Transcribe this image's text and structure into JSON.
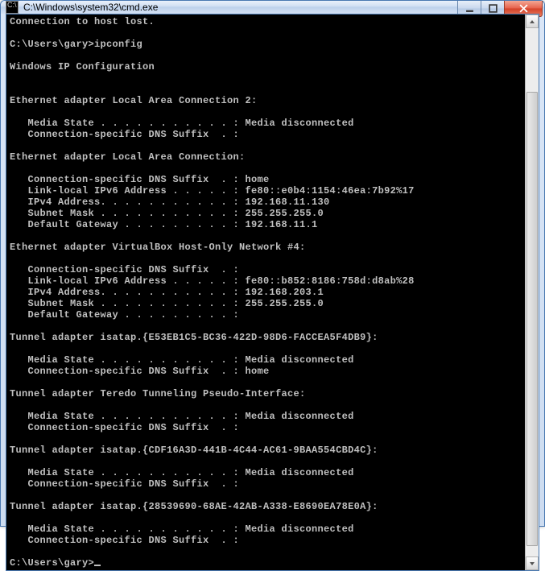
{
  "window": {
    "title": "C:\\Windows\\system32\\cmd.exe",
    "icon_glyph": "C:\\"
  },
  "scrollbar": {
    "thumb_top_pct": 12,
    "thumb_height_pct": 86
  },
  "console_lines": [
    "Connection to host lost.",
    "",
    "C:\\Users\\gary>ipconfig",
    "",
    "Windows IP Configuration",
    "",
    "",
    "Ethernet adapter Local Area Connection 2:",
    "",
    "   Media State . . . . . . . . . . . : Media disconnected",
    "   Connection-specific DNS Suffix  . :",
    "",
    "Ethernet adapter Local Area Connection:",
    "",
    "   Connection-specific DNS Suffix  . : home",
    "   Link-local IPv6 Address . . . . . : fe80::e0b4:1154:46ea:7b92%17",
    "   IPv4 Address. . . . . . . . . . . : 192.168.11.130",
    "   Subnet Mask . . . . . . . . . . . : 255.255.255.0",
    "   Default Gateway . . . . . . . . . : 192.168.11.1",
    "",
    "Ethernet adapter VirtualBox Host-Only Network #4:",
    "",
    "   Connection-specific DNS Suffix  . :",
    "   Link-local IPv6 Address . . . . . : fe80::b852:8186:758d:d8ab%28",
    "   IPv4 Address. . . . . . . . . . . : 192.168.203.1",
    "   Subnet Mask . . . . . . . . . . . : 255.255.255.0",
    "   Default Gateway . . . . . . . . . :",
    "",
    "Tunnel adapter isatap.{E53EB1C5-BC36-422D-98D6-FACCEA5F4DB9}:",
    "",
    "   Media State . . . . . . . . . . . : Media disconnected",
    "   Connection-specific DNS Suffix  . : home",
    "",
    "Tunnel adapter Teredo Tunneling Pseudo-Interface:",
    "",
    "   Media State . . . . . . . . . . . : Media disconnected",
    "   Connection-specific DNS Suffix  . :",
    "",
    "Tunnel adapter isatap.{CDF16A3D-441B-4C44-AC61-9BAA554CBD4C}:",
    "",
    "   Media State . . . . . . . . . . . : Media disconnected",
    "   Connection-specific DNS Suffix  . :",
    "",
    "Tunnel adapter isatap.{28539690-68AE-42AB-A338-E8690EA78E0A}:",
    "",
    "   Media State . . . . . . . . . . . : Media disconnected",
    "   Connection-specific DNS Suffix  . :",
    "",
    "C:\\Users\\gary>"
  ]
}
